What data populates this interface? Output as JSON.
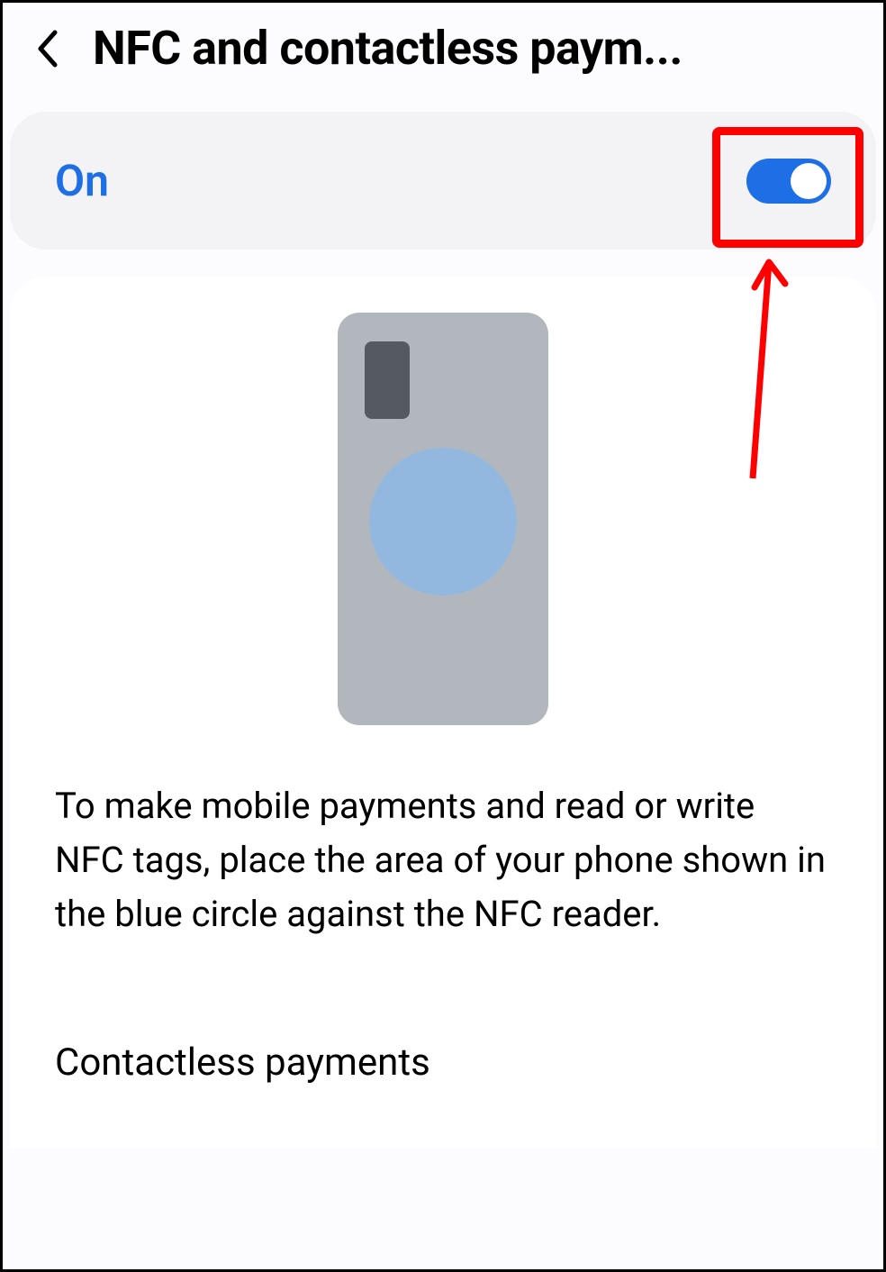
{
  "header": {
    "title": "NFC and contactless paym..."
  },
  "toggle": {
    "label": "On",
    "state": "on"
  },
  "description": "To make mobile payments and read or write NFC tags, place the area of your phone shown in the blue circle against the NFC reader.",
  "menu": {
    "contactless_label": "Contactless payments"
  },
  "annotation": {
    "highlighted_element": "nfc-toggle-switch"
  }
}
